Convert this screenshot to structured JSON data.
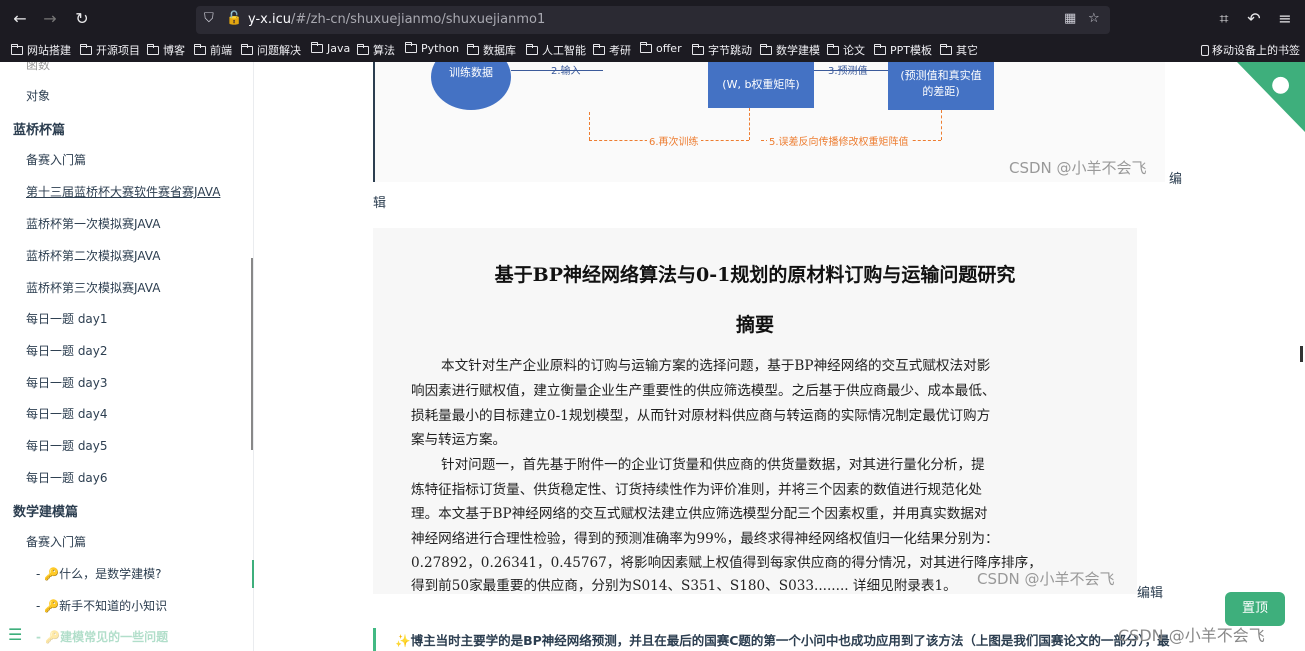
{
  "browser": {
    "url_host": "y-x.icu",
    "url_path": "/#/zh-cn/shuxuejianmo/shuxuejianmo1",
    "bookmarks": [
      "网站搭建",
      "开源项目",
      "博客",
      "前端",
      "问题解决",
      "Java",
      "算法",
      "Python",
      "数据库",
      "人工智能",
      "考研",
      "offer",
      "字节跳动",
      "数学建模",
      "论文",
      "PPT模板",
      "其它"
    ],
    "mobile_bookmarks": "移动设备上的书签"
  },
  "sidebar": {
    "items": [
      {
        "label": "函数",
        "level": "sub"
      },
      {
        "label": "对象",
        "level": "sub"
      },
      {
        "label": "蓝桥杯篇",
        "level": "group"
      },
      {
        "label": "备赛入门篇",
        "level": "sub"
      },
      {
        "label": "第十三届蓝桥杯大赛软件赛省赛JAVA",
        "level": "sub"
      },
      {
        "label": "蓝桥杯第一次模拟赛JAVA",
        "level": "sub"
      },
      {
        "label": "蓝桥杯第二次模拟赛JAVA",
        "level": "sub"
      },
      {
        "label": "蓝桥杯第三次模拟赛JAVA",
        "level": "sub"
      },
      {
        "label": "每日一题 day1",
        "level": "sub"
      },
      {
        "label": "每日一题 day2",
        "level": "sub"
      },
      {
        "label": "每日一题 day3",
        "level": "sub"
      },
      {
        "label": "每日一题 day4",
        "level": "sub"
      },
      {
        "label": "每日一题 day5",
        "level": "sub"
      },
      {
        "label": "每日一题 day6",
        "level": "sub"
      },
      {
        "label": "数学建模篇",
        "level": "group"
      },
      {
        "label": "备赛入门篇",
        "level": "sub"
      },
      {
        "label": "- 🔑什么，是数学建模?",
        "level": "sub2"
      },
      {
        "label": "- 🔑新手不知道的小知识",
        "level": "sub2"
      },
      {
        "label": "- 🔑建模常见的一些问题",
        "level": "sub2"
      }
    ]
  },
  "diagram": {
    "circle_label": "训练数据",
    "input_label": "2.输入",
    "weight_box": "(W, b权重矩阵)",
    "predict_label": "3.预测值",
    "error_box": "(预测值和真实值的差距)",
    "retrain_label": "6.再次训练",
    "backprop_label": "5.误差反向传播修改权重矩阵值",
    "watermark": "CSDN @小羊不会飞"
  },
  "edit_labels": [
    "编",
    "辑",
    "编辑"
  ],
  "paper": {
    "title": "基于BP神经网络算法与0-1规划的原材料订购与运输问题研究",
    "abstract_heading": "摘要",
    "lines": [
      "本文针对生产企业原料的订购与运输方案的选择问题，基于BP神经网络的交互式赋权法对影",
      "响因素进行赋权值，建立衡量企业生产重要性的供应筛选模型。之后基于供应商最少、成本最低、",
      "损耗量最小的目标建立0-1规划模型，从而针对原材料供应商与转运商的实际情况制定最优订购方",
      "案与转运方案。",
      "针对问题一，首先基于附件一的企业订货量和供应商的供货量数据，对其进行量化分析，提",
      "炼特征指标订货量、供货稳定性、订货持续性作为评价准则，并将三个因素的数值进行规范化处",
      "理。本文基于BP神经网络的交互式赋权法建立供应筛选模型分配三个因素权重，并用真实数据对",
      "神经网络进行合理性检验，得到的预测准确率为99%，最终求得神经网络权值归一化结果分别为：",
      "0.27892，0.26341，0.45767，将影响因素赋上权值得到每家供应商的得分情况，对其进行降序排序，",
      "得到前50家最重要的供应商，分别为S014、S351、S180、S033........ 详细见附录表1。"
    ],
    "watermark": "CSDN @小羊不会飞"
  },
  "note": "✨博主当时主要学的是BP神经网络预测，并且在最后的国赛C题的第一个小问中也成功应用到了该方法（上图是我们国赛论文的一部分），最",
  "bottom_watermark": "CSDN @小羊不会飞",
  "top_button": "置顶"
}
